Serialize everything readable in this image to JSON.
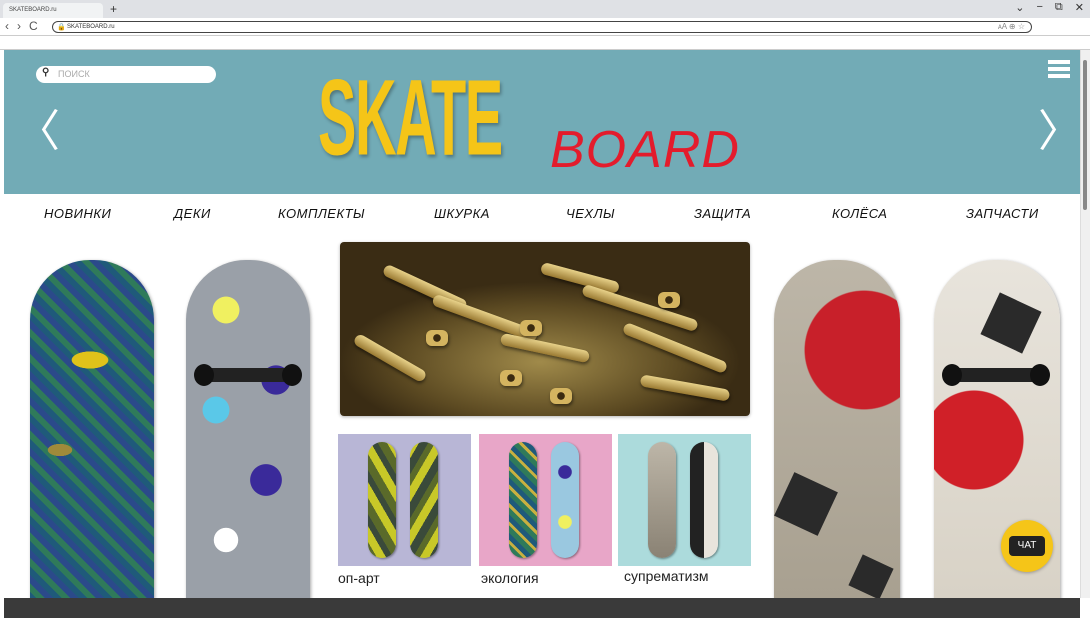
{
  "browser": {
    "tab_title": "SKATEBOARD.ru",
    "new_tab": "+",
    "url": "SKATEBOARD.ru",
    "window_controls": [
      "⌄",
      "−",
      "⧉",
      "✕"
    ],
    "nav_back": "‹",
    "nav_forward": "›",
    "reload": "C"
  },
  "header": {
    "search_placeholder": "ПОИСК",
    "logo_skate": "SKATE",
    "logo_board": "BOARD",
    "prev": "〈",
    "next": "〉"
  },
  "menu": [
    "НОВИНКИ",
    "ДЕКИ",
    "КОМПЛЕКТЫ",
    "ШКУРКА",
    "ЧЕХЛЫ",
    "ЗАЩИТА",
    "КОЛЁСА",
    "ЗАПЧАСТИ"
  ],
  "categories": [
    {
      "label": "оп-арт",
      "bg": "#b8b6d6"
    },
    {
      "label": "экология",
      "bg": "#e8a6c8"
    },
    {
      "label": "супрематизм",
      "bg": "#acdbdc"
    }
  ],
  "chat": {
    "label": "ЧАТ"
  },
  "colors": {
    "hero_bg": "#72abb6",
    "logo_yellow": "#f5c518",
    "logo_red": "#e31c2c"
  }
}
